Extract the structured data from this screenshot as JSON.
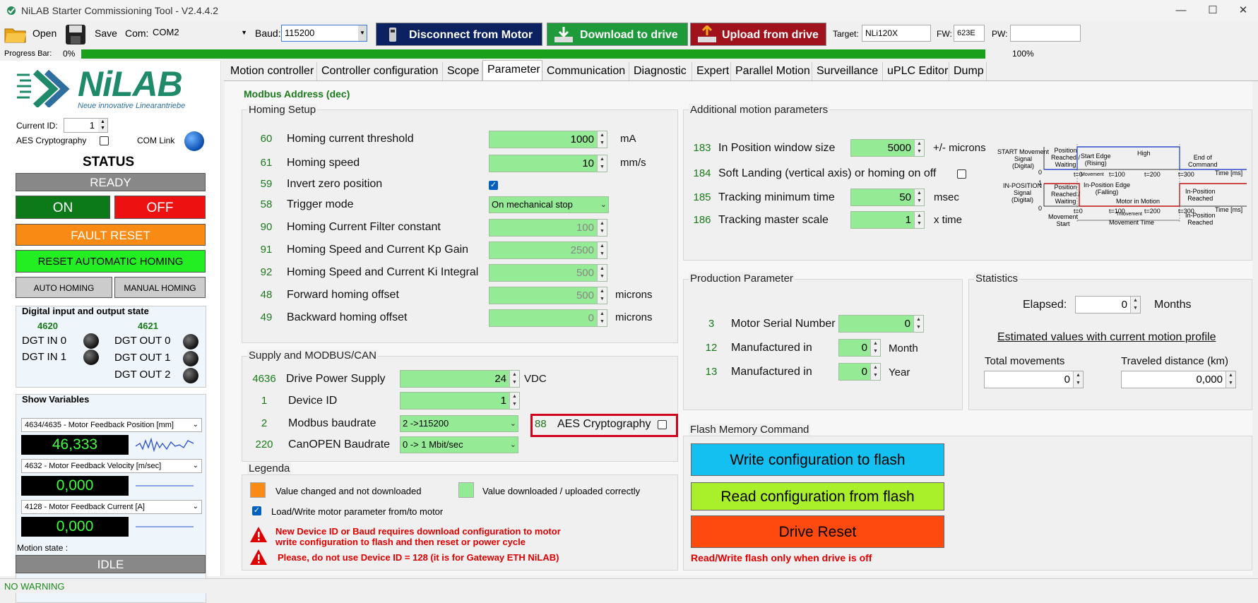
{
  "window": {
    "title": "NiLAB Starter Commissioning Tool - V2.4.4.2",
    "minimize": "—",
    "maximize": "☐",
    "close": "✕"
  },
  "toolbar": {
    "open_label": "Open",
    "save_label": "Save",
    "com_label": "Com:",
    "com_value": "COM2",
    "baud_label": "Baud:",
    "baud_value": "115200",
    "disconnect_label": "Disconnect from Motor",
    "download_label": "Download to drive",
    "upload_label": "Upload from drive",
    "target_label": "Target:",
    "target_value": "NLi120X",
    "fw_label": "FW:",
    "fw_value": "623E",
    "pw_label": "PW:",
    "pw_value": ""
  },
  "progress": {
    "label": "Progress Bar:",
    "start": "0%",
    "end": "100%",
    "value": 1.0
  },
  "sidebar": {
    "logo_text": "NiLAB",
    "logo_sub": "Neue innovative Linearantriebe",
    "current_id_label": "Current ID:",
    "current_id_value": "1",
    "aes_label": "AES Cryptography",
    "com_link_label": "COM Link",
    "status_title": "STATUS",
    "status_value": "READY",
    "on_label": "ON",
    "off_label": "OFF",
    "fault_reset_label": "FAULT RESET",
    "reset_homing_label": "RESET AUTOMATIC HOMING",
    "auto_homing_label": "AUTO HOMING",
    "manual_homing_label": "MANUAL HOMING",
    "dio_title": "Digital input and output state",
    "dio_in_addr": "4620",
    "dio_out_addr": "4621",
    "dgt_in": [
      "DGT IN 0",
      "DGT IN 1"
    ],
    "dgt_out": [
      "DGT OUT 0",
      "DGT OUT 1",
      "DGT OUT 2"
    ],
    "show_vars_title": "Show Variables",
    "vars": [
      {
        "name": "4634/4635 - Motor Feedback Position [mm]",
        "value": "46,333"
      },
      {
        "name": "4632 - Motor Feedback Velocity [m/sec]",
        "value": "0,000"
      },
      {
        "name": "4128 - Motor Feedback Current [A]",
        "value": "0,000"
      }
    ],
    "motion_state_label": "Motion state :",
    "motion_state_value": "IDLE"
  },
  "tabs": [
    "Motion controller",
    "Controller configuration",
    "Scope",
    "Parameter",
    "Communication",
    "Diagnostic",
    "Expert",
    "Parallel Motion",
    "Surveillance",
    "uPLC Editor",
    "Dump"
  ],
  "active_tab": "Parameter",
  "modbus_header": "Modbus Address (dec)",
  "homing": {
    "title": "Homing Setup",
    "rows": [
      {
        "addr": "60",
        "label": "Homing current threshold",
        "value": "1000",
        "unit": "mA"
      },
      {
        "addr": "61",
        "label": "Homing speed",
        "value": "10",
        "unit": "mm/s"
      },
      {
        "addr": "59",
        "label": "Invert zero position"
      },
      {
        "addr": "58",
        "label": "Trigger mode",
        "value": "On mechanical stop"
      },
      {
        "addr": "90",
        "label": "Homing Current Filter constant",
        "value": "100"
      },
      {
        "addr": "91",
        "label": "Homing Speed and Current Kp Gain",
        "value": "2500"
      },
      {
        "addr": "92",
        "label": "Homing Speed and Current Ki Integral",
        "value": "500"
      },
      {
        "addr": "48",
        "label": "Forward homing offset",
        "value": "500",
        "unit": "microns"
      },
      {
        "addr": "49",
        "label": "Backward homing offset",
        "value": "0",
        "unit": "microns"
      }
    ]
  },
  "supply": {
    "title": "Supply and MODBUS/CAN",
    "rows": [
      {
        "addr": "4636",
        "label": "Drive Power Supply",
        "value": "24",
        "unit": "VDC"
      },
      {
        "addr": "1",
        "label": "Device ID",
        "value": "1"
      },
      {
        "addr": "2",
        "label": "Modbus baudrate",
        "value": "2 ->115200"
      },
      {
        "addr": "220",
        "label": "CanOPEN Baudrate",
        "value": "0 -> 1 Mbit/sec"
      }
    ],
    "aes_addr": "88",
    "aes_label": "AES Cryptography"
  },
  "legend": {
    "title": "Legenda",
    "changed": "Value changed and not downloaded",
    "downloaded": "Value downloaded / uploaded correctly",
    "load_write": "Load/Write motor parameter from/to motor",
    "warn1_line1": "New Device ID or Baud requires download configuration to motor",
    "warn1_line2": "write configuration to flash and then reset or power cycle",
    "warn2": "Please, do not use Device ID = 128 (it is for Gateway ETH NiLAB)"
  },
  "additional": {
    "title": "Additional motion parameters",
    "rows": [
      {
        "addr": "183",
        "label": "In Position window size",
        "value": "5000",
        "unit": "+/- microns"
      },
      {
        "addr": "184",
        "label": "Soft Landing (vertical axis) or homing on off"
      },
      {
        "addr": "185",
        "label": "Tracking minimum time",
        "value": "50",
        "unit": "msec"
      },
      {
        "addr": "186",
        "label": "Tracking master  scale",
        "value": "1",
        "unit": "x time"
      }
    ],
    "diagram": {
      "start_sig": [
        "START Movement",
        "Signal",
        "(Digital)"
      ],
      "inpos_sig": [
        "IN-POSITION",
        "Signal",
        "(Digital)"
      ],
      "pos_reached": [
        "Position",
        "Reached /",
        "Waiting"
      ],
      "start_edge": [
        "Start Edge",
        "(Rising)"
      ],
      "high": "High",
      "end_cmd": [
        "End of",
        "Command"
      ],
      "movement": "Movement",
      "inpos_edge": [
        "In-Position Edge",
        "(Falling)"
      ],
      "motor_in_motion": "Motor in Motion",
      "inpos_reached": [
        "In-Position",
        "Reached"
      ],
      "time_ms": "Time [ms]",
      "t0": "t=0",
      "t100": "t=100",
      "t200": "t=200",
      "t300": "t=300",
      "zero": "0",
      "one": "1",
      "mv_start": [
        "Movement",
        "Start"
      ],
      "t_movement": "Tmovement",
      "movement_time": "Movement Time"
    }
  },
  "production": {
    "title": "Production Parameter",
    "rows": [
      {
        "addr": "3",
        "label": "Motor Serial Number",
        "value": "0"
      },
      {
        "addr": "12",
        "label": "Manufactured in",
        "value": "0",
        "unit": "Month"
      },
      {
        "addr": "13",
        "label": "Manufactured in",
        "value": "0",
        "unit": "Year"
      }
    ]
  },
  "statistics": {
    "title": "Statistics",
    "elapsed_label": "Elapsed:",
    "elapsed_value": "0",
    "elapsed_unit": "Months",
    "estimated": "Estimated values with current motion profile",
    "total_label": "Total movements",
    "total_value": "0",
    "distance_label": "Traveled distance (km)",
    "distance_value": "0,000"
  },
  "flash": {
    "title": "Flash Memory Command",
    "write": "Write configuration to flash",
    "read": "Read configuration from flash",
    "reset": "Drive Reset",
    "note": "Read/Write flash only when drive is off"
  },
  "statusbar": {
    "text": "NO WARNING"
  },
  "colors": {
    "green_field": "#95ea95",
    "accent_green": "#1a7a1a",
    "warning_red": "#e00000",
    "highlight": "#d0021b"
  }
}
